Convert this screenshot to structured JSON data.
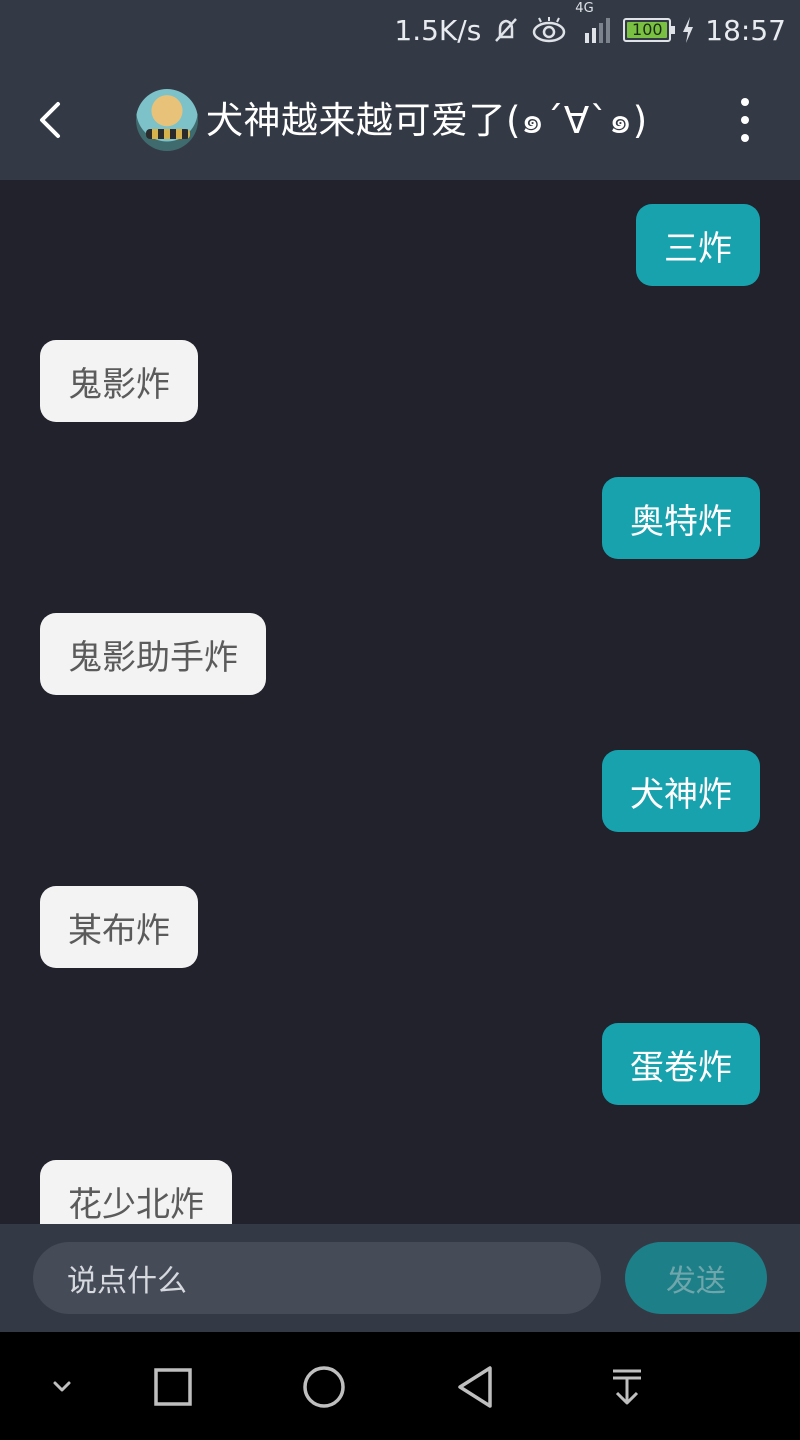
{
  "status_bar": {
    "speed": "1.5K/s",
    "network": "4G",
    "battery": "100",
    "time": "18:57"
  },
  "header": {
    "title": "犬神越来越可爱了(๑´∀`๑)",
    "back_icon": "chevron-left-icon",
    "more_icon": "more-vertical-icon"
  },
  "messages": [
    {
      "side": "me",
      "text": "三炸"
    },
    {
      "side": "them",
      "text": "鬼影炸"
    },
    {
      "side": "me",
      "text": "奥特炸"
    },
    {
      "side": "them",
      "text": "鬼影助手炸"
    },
    {
      "side": "me",
      "text": "犬神炸"
    },
    {
      "side": "them",
      "text": "某布炸"
    },
    {
      "side": "me",
      "text": "蛋卷炸"
    },
    {
      "side": "them",
      "text": "花少北炸"
    }
  ],
  "composer": {
    "placeholder": "说点什么",
    "send_label": "发送"
  },
  "colors": {
    "accent": "#17a2ae",
    "background": "#21222c",
    "bar": "#343a45"
  }
}
